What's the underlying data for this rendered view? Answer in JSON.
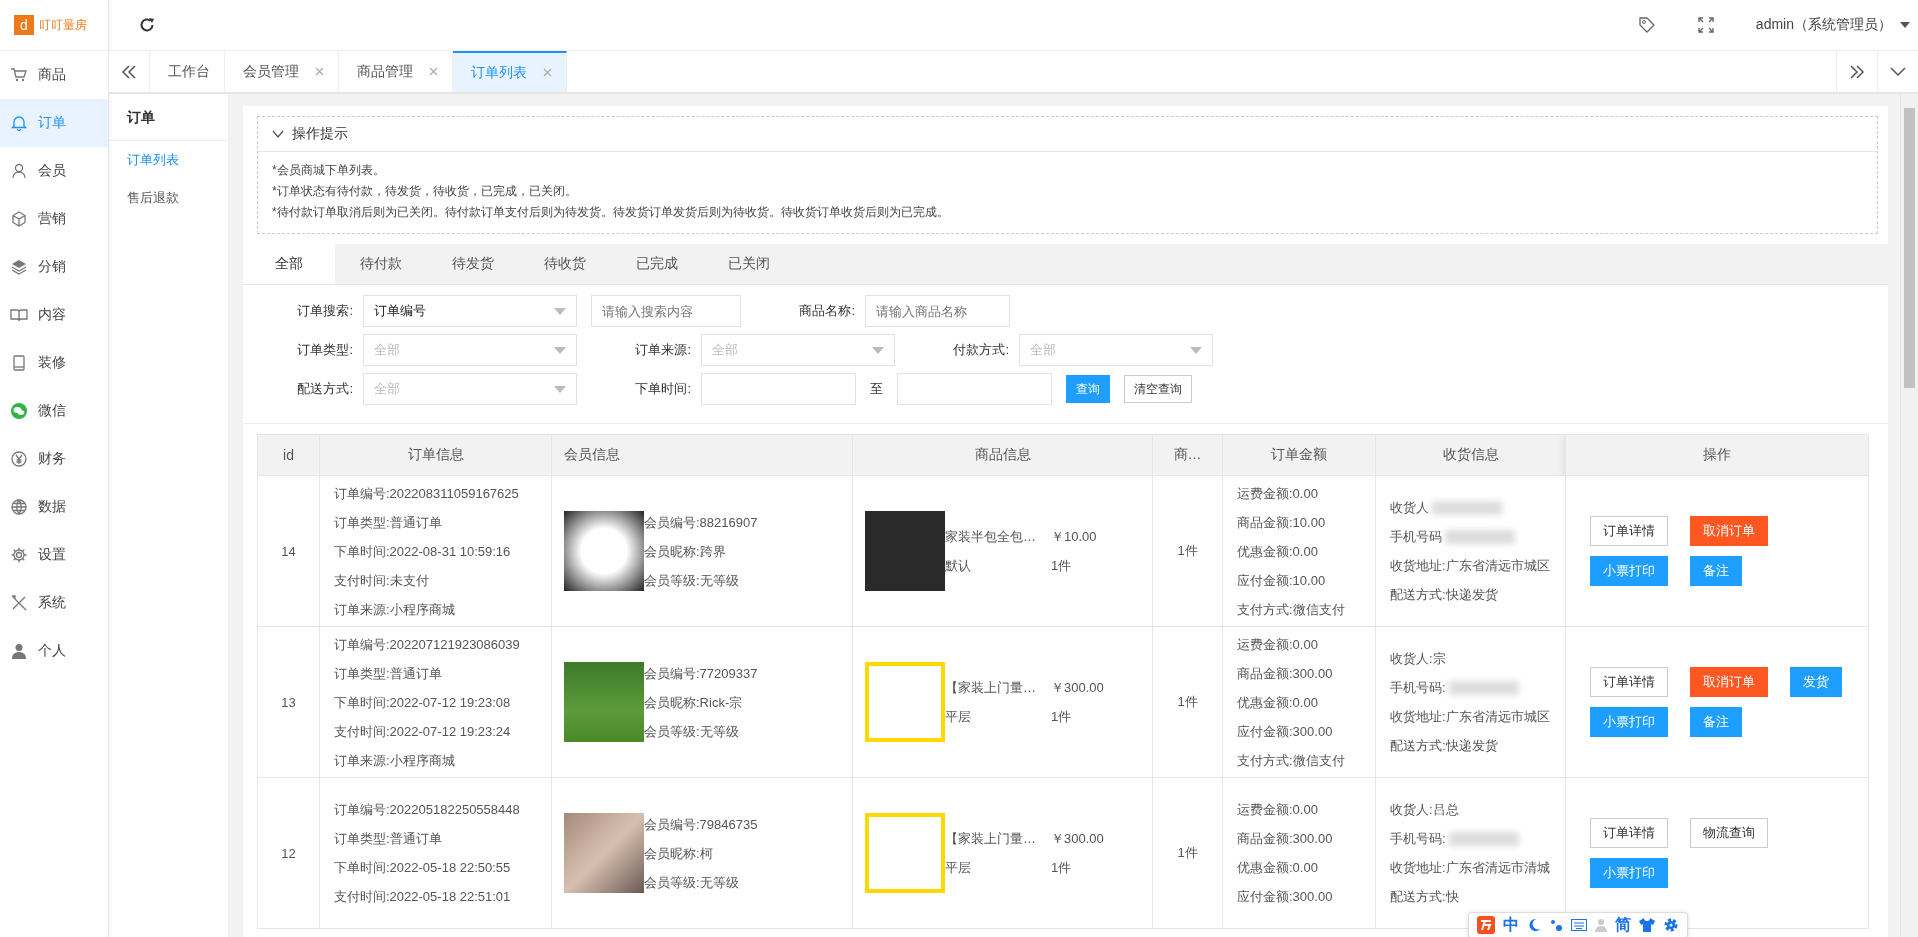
{
  "brand": {
    "logo_letter": "d",
    "name": "叮叮量房"
  },
  "topbar": {
    "user": "admin（系统管理员）"
  },
  "nav": [
    {
      "label": "商品",
      "selected": false
    },
    {
      "label": "订单",
      "selected": true
    },
    {
      "label": "会员",
      "selected": false
    },
    {
      "label": "营销",
      "selected": false
    },
    {
      "label": "分销",
      "selected": false
    },
    {
      "label": "内容",
      "selected": false
    },
    {
      "label": "装修",
      "selected": false
    },
    {
      "label": "微信",
      "selected": false
    },
    {
      "label": "财务",
      "selected": false
    },
    {
      "label": "数据",
      "selected": false
    },
    {
      "label": "设置",
      "selected": false
    },
    {
      "label": "系统",
      "selected": false
    },
    {
      "label": "个人",
      "selected": false
    }
  ],
  "tabs": [
    {
      "label": "工作台",
      "selected": false,
      "closable": false
    },
    {
      "label": "会员管理",
      "selected": false,
      "closable": true
    },
    {
      "label": "商品管理",
      "selected": false,
      "closable": true
    },
    {
      "label": "订单列表",
      "selected": true,
      "closable": true
    }
  ],
  "submenu": {
    "title": "订单",
    "items": [
      {
        "label": "订单列表",
        "selected": true
      },
      {
        "label": "售后退款",
        "selected": false
      }
    ]
  },
  "tips": {
    "title": "操作提示",
    "expanded": true,
    "lines": [
      "*会员商城下单列表。",
      "*订单状态有待付款，待发货，待收货，已完成，已关闭。",
      "*待付款订单取消后则为已关闭。待付款订单支付后则为待发货。待发货订单发货后则为待收货。待收货订单收货后则为已完成。"
    ]
  },
  "status_tabs": [
    {
      "label": "全部",
      "selected": true
    },
    {
      "label": "待付款",
      "selected": false
    },
    {
      "label": "待发货",
      "selected": false
    },
    {
      "label": "待收货",
      "selected": false
    },
    {
      "label": "已完成",
      "selected": false
    },
    {
      "label": "已关闭",
      "selected": false
    }
  ],
  "filters": [
    [
      {
        "label": "订单搜索:",
        "kind": "select",
        "value": "订单编号"
      },
      {
        "kind": "input",
        "placeholder": "请输入搜索内容"
      },
      {
        "label": "商品名称:",
        "kind": "input",
        "placeholder": "请输入商品名称"
      }
    ],
    [
      {
        "label": "订单类型:",
        "kind": "select",
        "placeholder": "全部"
      },
      {
        "label": "订单来源:",
        "kind": "select",
        "placeholder": "全部"
      },
      {
        "label": "付款方式:",
        "kind": "select",
        "placeholder": "全部"
      }
    ],
    [
      {
        "label": "配送方式:",
        "kind": "select",
        "placeholder": "全部"
      },
      {
        "label": "下单时间:",
        "kind": "input"
      },
      {
        "label": "至",
        "kind": "input"
      },
      {
        "kind": "button",
        "value": "查询",
        "primary": true
      },
      {
        "kind": "button",
        "value": "清空查询",
        "primary": false
      }
    ]
  ],
  "table": {
    "columns": [
      "id",
      "订单信息",
      "会员信息",
      "商品信息",
      "商…",
      "订单金额",
      "收货信息",
      "操作"
    ],
    "rows": [
      {
        "id": "14",
        "order": [
          "订单编号:202208311059167625",
          "订单类型:普通订单",
          "下单时间:2022-08-31 10:59:16",
          "支付时间:未支付",
          "订单来源:小程序商城"
        ],
        "member": {
          "lines": [
            "会员编号:88216907",
            "会员昵称:跨界",
            "会员等级:无等级"
          ]
        },
        "product": {
          "name": "家装半包全包…",
          "spec": "默认",
          "price": "￥10.00",
          "qty": "1件"
        },
        "qty": "1件",
        "amounts": [
          "运费金额:0.00",
          "商品金额:10.00",
          "优惠金额:0.00",
          "应付金额:10.00",
          "支付方式:微信支付"
        ],
        "shipping": [
          {
            "text": "收货人",
            "blurred": true
          },
          {
            "text": "手机号码",
            "blurred": true
          },
          {
            "text": "收货地址:广东省清远市城区",
            "blurred": false
          },
          {
            "text": "配送方式:快递发货",
            "blurred": false
          }
        ],
        "actions": [
          {
            "label": "订单详情",
            "kind": "default"
          },
          {
            "label": "取消订单",
            "kind": "danger"
          },
          {
            "label": "小票打印",
            "kind": "primary"
          },
          {
            "label": "备注",
            "kind": "primary"
          }
        ]
      },
      {
        "id": "13",
        "order": [
          "订单编号:202207121923086039",
          "订单类型:普通订单",
          "下单时间:2022-07-12 19:23:08",
          "支付时间:2022-07-12 19:23:24",
          "订单来源:小程序商城"
        ],
        "member": {
          "lines": [
            "会员编号:77209337",
            "会员昵称:Rick-宗",
            "会员等级:无等级"
          ]
        },
        "product": {
          "name": "【家装上门量…",
          "spec": "平层",
          "price": "￥300.00",
          "qty": "1件"
        },
        "qty": "1件",
        "amounts": [
          "运费金额:0.00",
          "商品金额:300.00",
          "优惠金额:0.00",
          "应付金额:300.00",
          "支付方式:微信支付"
        ],
        "shipping": [
          {
            "text": "收货人:宗",
            "blurred": false
          },
          {
            "text": "手机号码:",
            "blurred": true
          },
          {
            "text": "收货地址:广东省清远市城区",
            "blurred": false
          },
          {
            "text": "配送方式:快递发货",
            "blurred": false
          }
        ],
        "actions": [
          {
            "label": "订单详情",
            "kind": "default"
          },
          {
            "label": "取消订单",
            "kind": "danger"
          },
          {
            "label": "发货",
            "kind": "primary"
          },
          {
            "label": "小票打印",
            "kind": "primary"
          },
          {
            "label": "备注",
            "kind": "primary"
          }
        ]
      },
      {
        "id": "12",
        "order": [
          "订单编号:202205182250558448",
          "订单类型:普通订单",
          "下单时间:2022-05-18 22:50:55",
          "支付时间:2022-05-18 22:51:01"
        ],
        "member": {
          "lines": [
            "会员编号:79846735",
            "会员昵称:柯",
            "会员等级:无等级"
          ]
        },
        "product": {
          "name": "【家装上门量…",
          "spec": "平层",
          "price": "￥300.00",
          "qty": "1件"
        },
        "qty": "1件",
        "amounts": [
          "运费金额:0.00",
          "商品金额:300.00",
          "优惠金额:0.00",
          "应付金额:300.00"
        ],
        "shipping": [
          {
            "text": "收货人:吕总",
            "blurred": false
          },
          {
            "text": "手机号码:",
            "blurred": true
          },
          {
            "text": "收货地址:广东省清远市清城",
            "blurred": false
          },
          {
            "text": "配送方式:快",
            "blurred": false
          }
        ],
        "actions": [
          {
            "label": "订单详情",
            "kind": "default"
          },
          {
            "label": "物流查询",
            "kind": "default"
          },
          {
            "label": "小票打印",
            "kind": "primary"
          }
        ]
      }
    ]
  },
  "ime_toolbar": {
    "labels": [
      "中",
      "简"
    ]
  }
}
